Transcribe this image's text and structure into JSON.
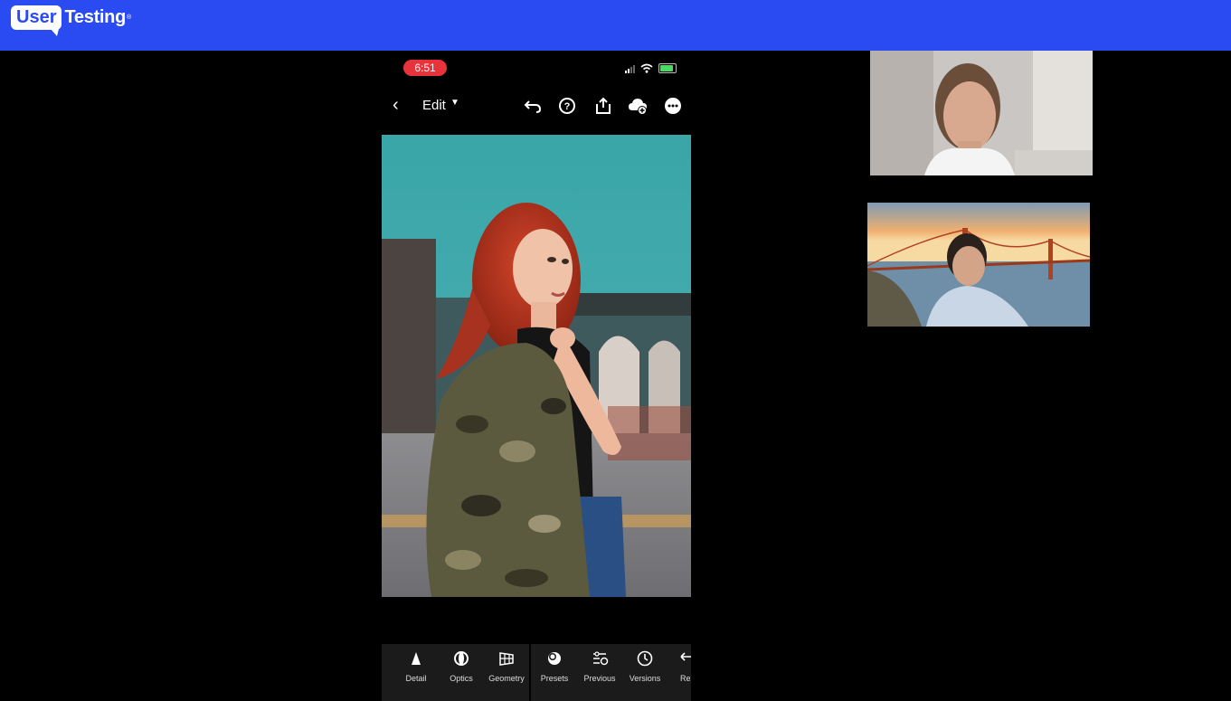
{
  "brand": {
    "logo_box": "User",
    "logo_word": "Testing",
    "trademark": "®"
  },
  "phone": {
    "status": {
      "time": "6:51"
    },
    "nav": {
      "edit_label": "Edit"
    },
    "toolbar": {
      "items": [
        {
          "label": "Detail"
        },
        {
          "label": "Optics"
        },
        {
          "label": "Geometry"
        },
        {
          "label": "Presets"
        },
        {
          "label": "Previous"
        },
        {
          "label": "Versions"
        },
        {
          "label": "Re"
        }
      ]
    }
  },
  "colors": {
    "brand_blue": "#2b4bf2",
    "status_red": "#e8333a"
  }
}
